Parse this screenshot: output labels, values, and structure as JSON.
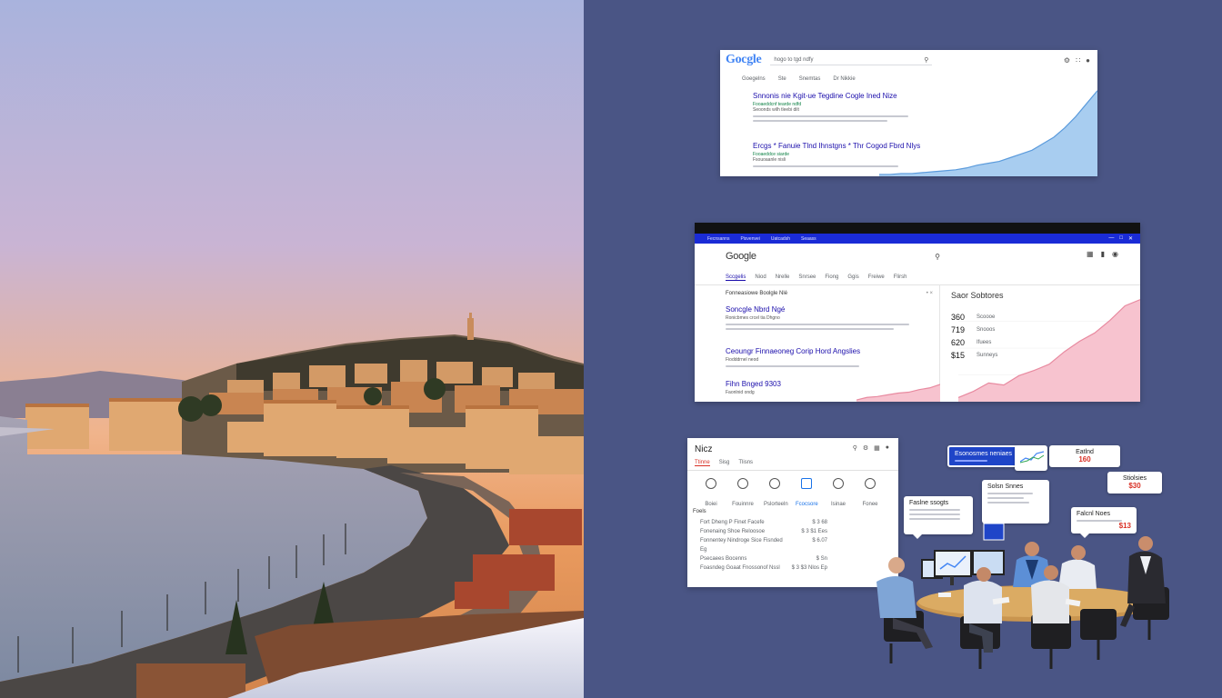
{
  "colors": {
    "right_bg": "#4a5585",
    "google_blue": "#4285f4",
    "result_link": "#1a0dab",
    "chart_blue": "#a8cdf0",
    "chart_pink": "#f7c3cf",
    "accent_red": "#d93025"
  },
  "photo": {
    "subject": "Nice coastline at sunset"
  },
  "card1": {
    "logo": "Gocgle",
    "search_text": "hogo to tgd ndfy",
    "search_icon": "search-icon",
    "toolbar_icons": [
      "settings-icon",
      "apps-icon",
      "account-icon"
    ],
    "nav": [
      "Goegelns",
      "Ste",
      "Snemtas",
      "Dr Nikkie"
    ],
    "results": [
      {
        "title": "Snnonis nie Kgit-ue Tegdine Cogle Ined Nize",
        "url": "Fooaeddcnf tearde ndfd",
        "snippet": "Seoonds wilh tleebi dilt"
      },
      {
        "title": "Ercgs * Fanuie Tlnd Ihnstgns * Thr Cogod Fbrd Nlys",
        "url": "Fooaeddce siarde",
        "snippet": "Fsouoaanle nisli"
      }
    ]
  },
  "card2": {
    "tabs": [
      "Fecnsanns",
      "Pisvenvei",
      "Uatcadsh",
      "Seaass"
    ],
    "logo": "Google",
    "search_icon": "search-icon",
    "header_icons": [
      "grid-icon",
      "bell-icon",
      "account-icon"
    ],
    "subnav": [
      "Sccgelis",
      "Niod",
      "Nrelle",
      "Snrsee",
      "Fiong",
      "Ggis",
      "Freiwe",
      "Flirsh"
    ],
    "left_header": "Fonneasiowe Boolgle Nlé",
    "results": [
      {
        "title": "Soncgle Nbrd Ngé",
        "url": "Ronicbmes crcel tia Dhgno"
      },
      {
        "title": "Ceoungr Finnaeoneg Corip Hord Angslies",
        "url": "Fiodddrnel neod"
      },
      {
        "title": "Fihn Bnged 9303",
        "url": "Faonlnid ondg"
      }
    ],
    "right_title": "Saor Sobtores",
    "stats": [
      {
        "value": "360",
        "label": "Scoooe"
      },
      {
        "value": "719",
        "label": "Snooos"
      },
      {
        "value": "620",
        "label": "Ifuees"
      },
      {
        "value": "$15",
        "label": "Sunneys"
      }
    ]
  },
  "chart_left": {
    "type": "area",
    "series": [
      {
        "values": [
          2,
          2,
          3,
          3,
          4,
          5,
          6,
          7,
          9,
          12,
          14,
          16,
          20,
          24,
          28,
          35,
          42,
          52,
          64,
          78,
          92
        ]
      }
    ]
  },
  "chart_mid": {
    "type": "area",
    "series": [
      {
        "values": [
          4,
          10,
          18,
          16,
          25,
          30,
          36,
          48,
          58,
          66,
          78,
          92,
          98
        ]
      }
    ]
  },
  "chart_mini": {
    "type": "area",
    "series": [
      {
        "values": [
          2,
          5,
          6,
          8,
          10,
          11,
          14,
          16,
          20
        ]
      }
    ]
  },
  "card3": {
    "title": "Nicz",
    "title_icons": [
      "search-icon",
      "settings-icon",
      "grid-icon",
      "account-icon"
    ],
    "tabs": [
      "Ttinne",
      "Sisg",
      "Tlisns"
    ],
    "icons": [
      {
        "name": "calendar-icon",
        "label": "Boiei"
      },
      {
        "name": "clock-icon",
        "label": "Fouinnre"
      },
      {
        "name": "globe-icon",
        "label": "Pslorteeln"
      },
      {
        "name": "document-icon",
        "label": "Fcocsore"
      },
      {
        "name": "people-icon",
        "label": "Isinae"
      },
      {
        "name": "message-icon",
        "label": "Fonee"
      }
    ],
    "section": "Foels",
    "rows": [
      {
        "left": "Fort Dheng P Finet Facefe",
        "right": "$ 3 68"
      },
      {
        "left": "Fonenaing Shoe Reloosoe",
        "right": "$ 3 $1 Ees"
      },
      {
        "left": "Fonnentey Nindroge Sice Fisnded",
        "right": "$ 6.07"
      },
      {
        "left": "Eg",
        "right": ""
      },
      {
        "left": "Psecaees Bocenns",
        "right": "$ Sn"
      },
      {
        "left": "Foasndeg Goaat Fnossonof Nssl",
        "right": "$ 3 $3 Nlos Ep"
      }
    ]
  },
  "meeting": {
    "bubbles": [
      {
        "title": "Esonosmes neniaes",
        "value": ""
      },
      {
        "title": "Eatlnd",
        "value": "160"
      },
      {
        "title": "Stiolsies",
        "value": "$30"
      },
      {
        "title": "Solsn Snnes",
        "value": ""
      },
      {
        "title": "Faslne ssogts",
        "value": ""
      },
      {
        "title": "Falcnl Noes",
        "value": "$13"
      }
    ],
    "people_count": 6
  }
}
